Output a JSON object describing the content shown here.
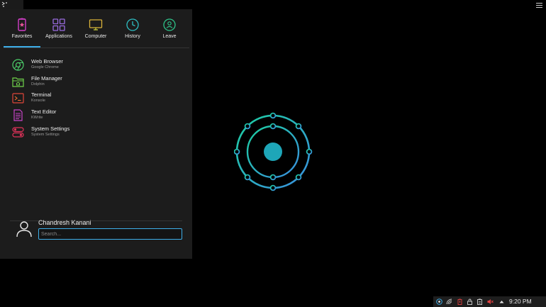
{
  "menu": {
    "tabs": [
      {
        "label": "Favorites",
        "icon": "favorites-icon",
        "active": true
      },
      {
        "label": "Applications",
        "icon": "applications-icon"
      },
      {
        "label": "Computer",
        "icon": "computer-icon"
      },
      {
        "label": "History",
        "icon": "history-icon"
      },
      {
        "label": "Leave",
        "icon": "leave-icon"
      }
    ],
    "favorites": [
      {
        "title": "Web Browser",
        "subtitle": "Google Chrome",
        "icon": "chrome-icon",
        "color": "#4ccf6a"
      },
      {
        "title": "File Manager",
        "subtitle": "Dolphin",
        "icon": "folder-icon",
        "color": "#6fd24a"
      },
      {
        "title": "Terminal",
        "subtitle": "Konsole",
        "icon": "terminal-icon",
        "color": "#e0463a"
      },
      {
        "title": "Text Editor",
        "subtitle": "KWrite",
        "icon": "text-editor-icon",
        "color": "#c844c8"
      },
      {
        "title": "System Settings",
        "subtitle": "System Settings",
        "icon": "settings-icon",
        "color": "#e0325a"
      }
    ],
    "user_name": "Chandresh Kanani",
    "search_placeholder": "Search..."
  },
  "tray": {
    "time": "9:20 PM",
    "icons": [
      "kde-connect-icon",
      "network-icon",
      "battery-icon",
      "lock-icon",
      "clipboard-icon",
      "volume-muted-icon",
      "expand-arrow-icon"
    ]
  },
  "colors": {
    "accent": "#3daee9",
    "logo_gradient_start": "#1ccfa0",
    "logo_gradient_end": "#3a8ee0"
  }
}
